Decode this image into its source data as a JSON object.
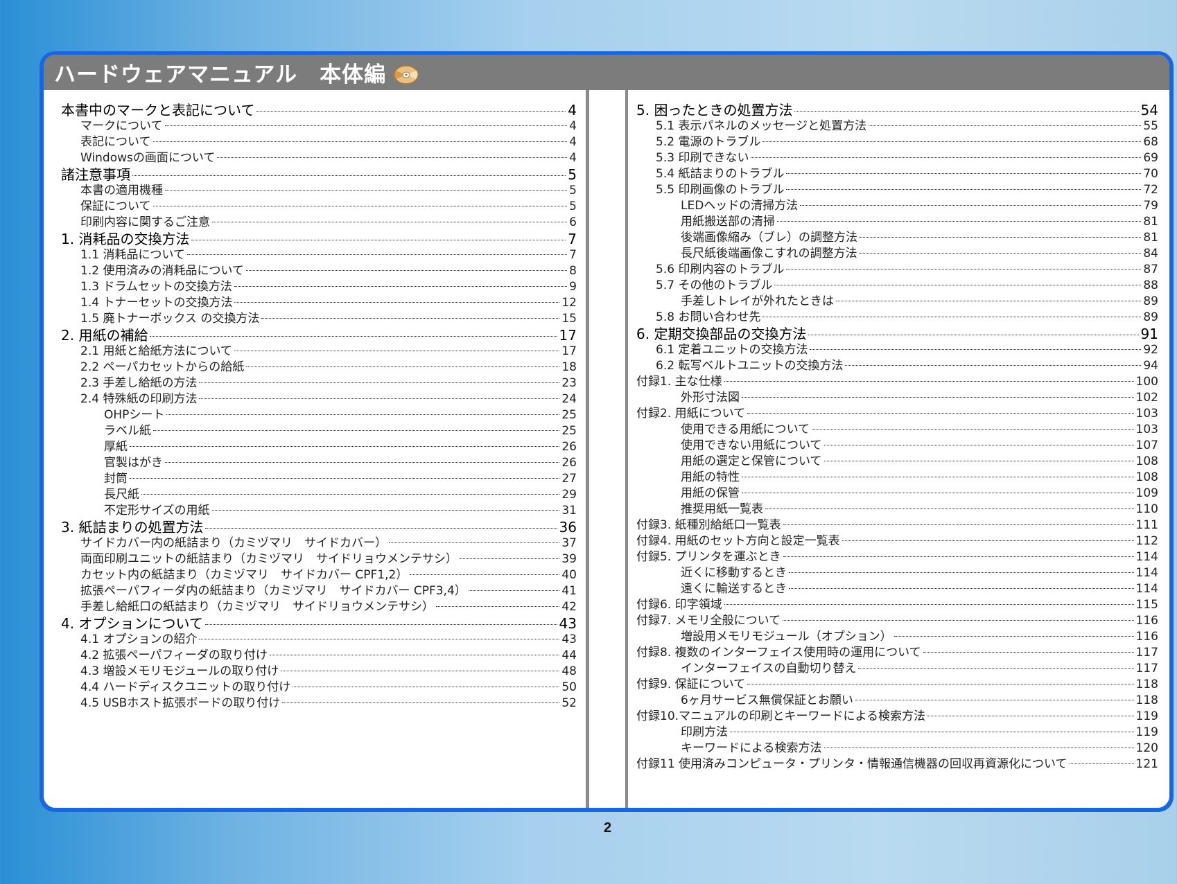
{
  "title": "ハードウェアマニュアル　本体編",
  "page_number": "2",
  "left_column": [
    {
      "level": 1,
      "label": "本書中のマークと表記について",
      "page": "4"
    },
    {
      "level": 2,
      "label": "マークについて",
      "page": "4"
    },
    {
      "level": 2,
      "label": "表記について",
      "page": "4"
    },
    {
      "level": 2,
      "label": "Windowsの画面について",
      "page": "4"
    },
    {
      "level": 1,
      "label": "諸注意事項",
      "page": "5"
    },
    {
      "level": 2,
      "label": "本書の適用機種",
      "page": "5"
    },
    {
      "level": 2,
      "label": "保証について",
      "page": "5"
    },
    {
      "level": 2,
      "label": "印刷内容に関するご注意",
      "page": "6"
    },
    {
      "level": 1,
      "label": "1. 消耗品の交換方法",
      "page": "7"
    },
    {
      "level": 2,
      "label": "1.1  消耗品について",
      "page": "7"
    },
    {
      "level": 2,
      "label": "1.2  使用済みの消耗品について",
      "page": "8"
    },
    {
      "level": 2,
      "label": "1.3  ドラムセットの交換方法",
      "page": "9"
    },
    {
      "level": 2,
      "label": "1.4  トナーセットの交換方法",
      "page": "12"
    },
    {
      "level": 2,
      "label": "1.5  廃トナーボックス の交換方法",
      "page": "15"
    },
    {
      "level": 1,
      "label": "2. 用紙の補給",
      "page": "17"
    },
    {
      "level": 2,
      "label": "2.1  用紙と給紙方法について",
      "page": "17"
    },
    {
      "level": 2,
      "label": "2.2  ペーパカセットからの給紙",
      "page": "18"
    },
    {
      "level": 2,
      "label": "2.3  手差し給紙の方法",
      "page": "23"
    },
    {
      "level": 2,
      "label": "2.4  特殊紙の印刷方法",
      "page": "24"
    },
    {
      "level": 3,
      "label": "OHPシート",
      "page": "25"
    },
    {
      "level": 3,
      "label": "ラベル紙",
      "page": "25"
    },
    {
      "level": 3,
      "label": "厚紙",
      "page": "26"
    },
    {
      "level": 3,
      "label": "官製はがき",
      "page": "26"
    },
    {
      "level": 3,
      "label": "封筒",
      "page": "27"
    },
    {
      "level": 3,
      "label": "長尺紙",
      "page": "29"
    },
    {
      "level": 3,
      "label": "不定形サイズの用紙",
      "page": "31"
    },
    {
      "level": 1,
      "label": "3. 紙詰まりの処置方法",
      "page": "36"
    },
    {
      "level": 2,
      "label": "サイドカバー内の紙詰まり（カミヅマリ　サイドカバー）",
      "page": "37"
    },
    {
      "level": 2,
      "label": "両面印刷ユニットの紙詰まり（カミヅマリ　サイドリョウメンテサシ）",
      "page": "39"
    },
    {
      "level": 2,
      "label": "カセット内の紙詰まり（カミヅマリ　サイドカバー CPF1,2）",
      "page": "40"
    },
    {
      "level": 2,
      "label": "拡張ペーパフィーダ内の紙詰まり（カミヅマリ　サイドカバー CPF3,4）",
      "page": "41"
    },
    {
      "level": 2,
      "label": "手差し給紙口の紙詰まり（カミヅマリ　サイドリョウメンテサシ）",
      "page": "42"
    },
    {
      "level": 1,
      "label": "4. オプションについて",
      "page": "43"
    },
    {
      "level": 2,
      "label": "4.1  オプションの紹介",
      "page": "43"
    },
    {
      "level": 2,
      "label": "4.2  拡張ペーパフィーダの取り付け",
      "page": "44"
    },
    {
      "level": 2,
      "label": "4.3  増設メモリモジュールの取り付け",
      "page": "48"
    },
    {
      "level": 2,
      "label": "4.4  ハードディスクユニットの取り付け",
      "page": "50"
    },
    {
      "level": 2,
      "label": "4.5  USBホスト拡張ボードの取り付け",
      "page": "52"
    }
  ],
  "right_column": [
    {
      "level": 1,
      "label": "5. 困ったときの処置方法",
      "page": "54"
    },
    {
      "level": 2,
      "label": "5.1  表示パネルのメッセージと処置方法",
      "page": "55"
    },
    {
      "level": 2,
      "label": "5.2  電源のトラブル",
      "page": "68"
    },
    {
      "level": 2,
      "label": "5.3  印刷できない",
      "page": "69"
    },
    {
      "level": 2,
      "label": "5.4  紙詰まりのトラブル",
      "page": "70"
    },
    {
      "level": 2,
      "label": "5.5  印刷画像のトラブル",
      "page": "72"
    },
    {
      "level": 3,
      "label": "LEDヘッドの清掃方法",
      "page": "79"
    },
    {
      "level": 3,
      "label": "用紙搬送部の清掃",
      "page": "81"
    },
    {
      "level": 3,
      "label": "後端画像縮み（ブレ）の調整方法",
      "page": "81"
    },
    {
      "level": 3,
      "label": "長尺紙後端画像こすれの調整方法",
      "page": "84"
    },
    {
      "level": 2,
      "label": "5.6 印刷内容のトラブル",
      "page": "87"
    },
    {
      "level": 2,
      "label": "5.7 その他のトラブル",
      "page": "88"
    },
    {
      "level": 3,
      "label": "手差しトレイが外れたときは",
      "page": "89"
    },
    {
      "level": 2,
      "label": "5.8  お問い合わせ先",
      "page": "89"
    },
    {
      "level": 1,
      "label": "6. 定期交換部品の交換方法",
      "page": "91"
    },
    {
      "level": 2,
      "label": "6.1  定着ユニットの交換方法",
      "page": "92"
    },
    {
      "level": 2,
      "label": "6.2  転写ベルトユニットの交換方法",
      "page": "94"
    },
    {
      "level": 0,
      "label": "付録1.  主な仕様",
      "page": "100"
    },
    {
      "level": 3,
      "label": "外形寸法図",
      "page": "102"
    },
    {
      "level": 0,
      "label": "付録2.  用紙について",
      "page": "103"
    },
    {
      "level": 3,
      "label": "使用できる用紙について",
      "page": "103"
    },
    {
      "level": 3,
      "label": "使用できない用紙について",
      "page": "107"
    },
    {
      "level": 3,
      "label": "用紙の選定と保管について",
      "page": "108"
    },
    {
      "level": 3,
      "label": "用紙の特性",
      "page": "108"
    },
    {
      "level": 3,
      "label": "用紙の保管",
      "page": "109"
    },
    {
      "level": 3,
      "label": "推奨用紙一覧表",
      "page": "110"
    },
    {
      "level": 0,
      "label": "付録3.  紙種別給紙口一覧表",
      "page": "111"
    },
    {
      "level": 0,
      "label": "付録4.  用紙のセット方向と設定一覧表",
      "page": "112"
    },
    {
      "level": 0,
      "label": "付録5.  プリンタを運ぶとき",
      "page": "114"
    },
    {
      "level": 3,
      "label": "近くに移動するとき",
      "page": "114"
    },
    {
      "level": 3,
      "label": "遠くに輸送するとき",
      "page": "114"
    },
    {
      "level": 0,
      "label": "付録6.  印字領域",
      "page": "115"
    },
    {
      "level": 0,
      "label": "付録7.  メモリ全般について",
      "page": "116"
    },
    {
      "level": 3,
      "label": "増設用メモリモジュール（オプション）",
      "page": "116"
    },
    {
      "level": 0,
      "label": "付録8.  複数のインターフェイス使用時の運用について",
      "page": "117"
    },
    {
      "level": 3,
      "label": "インターフェイスの自動切り替え",
      "page": "117"
    },
    {
      "level": 0,
      "label": "付録9.  保証について",
      "page": "118"
    },
    {
      "level": 3,
      "label": "6ヶ月サービス無償保証とお願い",
      "page": "118"
    },
    {
      "level": 0,
      "label": "付録10.マニュアルの印刷とキーワードによる検索方法",
      "page": "119"
    },
    {
      "level": 3,
      "label": "印刷方法",
      "page": "119"
    },
    {
      "level": 3,
      "label": "キーワードによる検索方法",
      "page": "120"
    },
    {
      "level": 0,
      "label": "付録11 使用済みコンピュータ・プリンタ・情報通信機器の回収再資源化について",
      "page": "121"
    }
  ],
  "icons": {
    "title_icon": "cd-disc-icon"
  },
  "colors": {
    "frame": "#1967e0",
    "titlebar": "#7c7c7c",
    "divider": "#8a8a8a"
  }
}
